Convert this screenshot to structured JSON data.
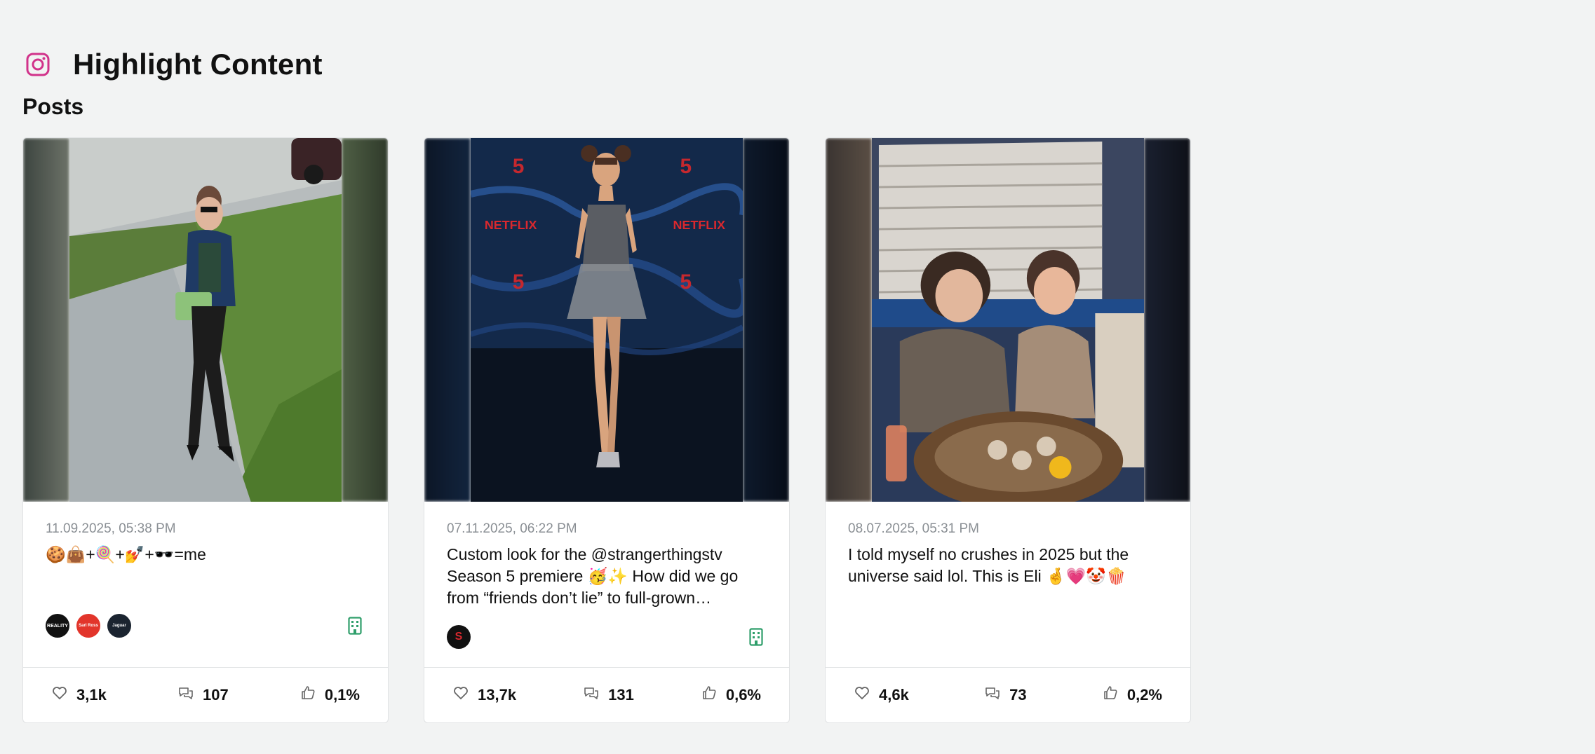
{
  "header": {
    "title": "Highlight Content",
    "icon": "instagram-icon",
    "icon_color": "#d1328a"
  },
  "section": {
    "title": "Posts"
  },
  "posts": [
    {
      "date": "11.09.2025, 05:38 PM",
      "caption": "🍪👜+🍭+💅+🕶️=me",
      "brands": [
        {
          "name": "REALITY",
          "color": "#111111"
        },
        {
          "name": "Sarl Ross",
          "color": "#e2352b"
        },
        {
          "name": "Jaguar",
          "color": "#1b2430"
        }
      ],
      "building_icon": "building-icon",
      "likes": "3,1k",
      "comments": "107",
      "engagement": "0,1%"
    },
    {
      "date": "07.11.2025, 06:22 PM",
      "caption": "Custom look for the @strangerthingstv Season 5 premiere 🥳✨ How did we go from “friends don’t lie” to full-grown…",
      "brands": [
        {
          "name": "S",
          "color": "#111111"
        }
      ],
      "building_icon": "building-icon",
      "likes": "13,7k",
      "comments": "131",
      "engagement": "0,6%"
    },
    {
      "date": "08.07.2025, 05:31 PM",
      "caption": "I told myself no crushes in 2025 but the universe said lol. This is Eli 🤞💗🤡🍿",
      "brands": [],
      "building_icon": "",
      "likes": "4,6k",
      "comments": "73",
      "engagement": "0,2%"
    }
  ],
  "colors": {
    "accent_green": "#2e9e6a",
    "date_gray": "#8a8f94"
  }
}
